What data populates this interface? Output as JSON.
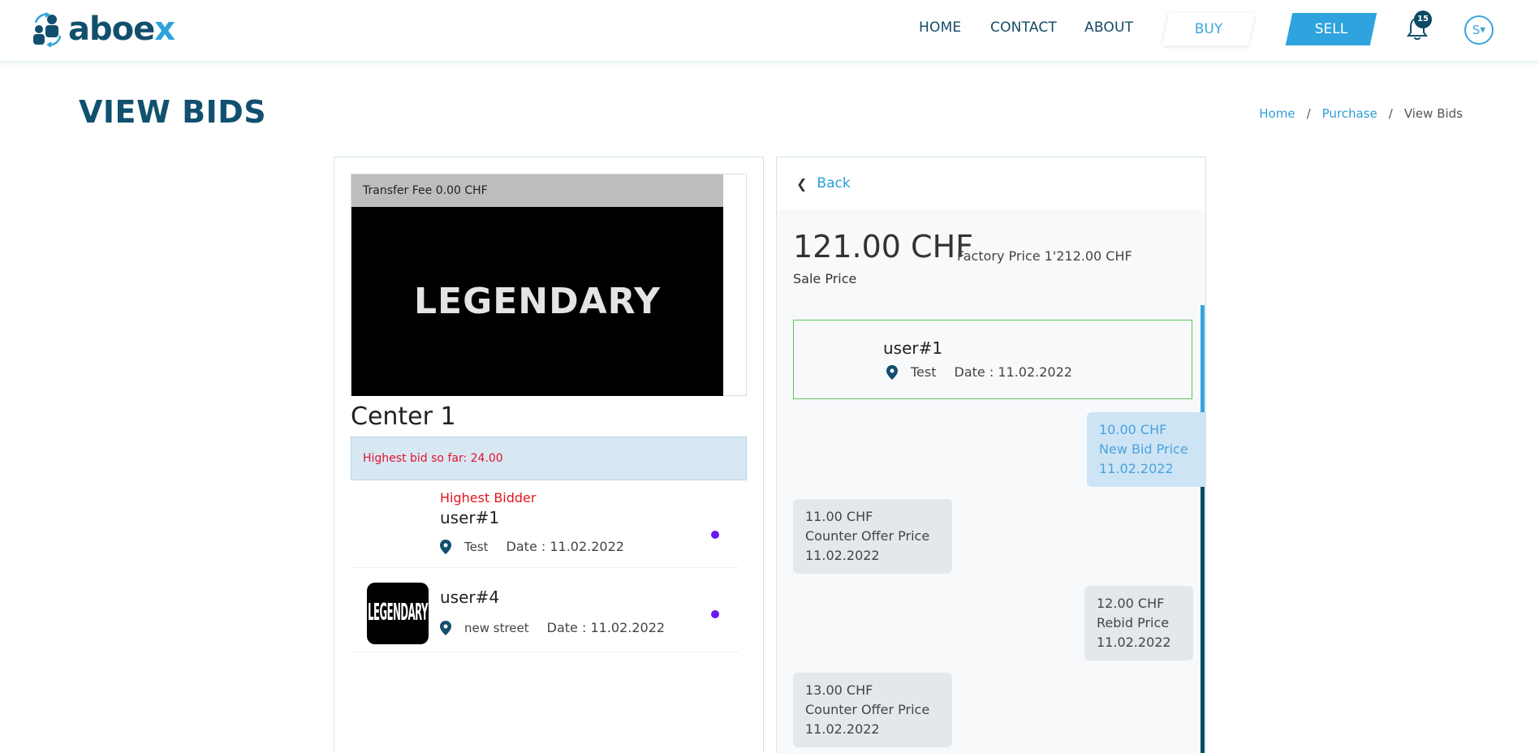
{
  "header": {
    "logo_text_main": "aboe",
    "logo_text_accent": "x",
    "nav": {
      "home": "HOME",
      "contact": "CONTACT",
      "about": "ABOUT"
    },
    "buy_label": "BUY",
    "sell_label": "SELL",
    "notification_count": "15",
    "avatar_initial": "S",
    "icons": {
      "bell": "bell-icon",
      "dropdown": "caret-down-icon"
    }
  },
  "page": {
    "title": "VIEW BIDS",
    "breadcrumb": {
      "home": "Home",
      "sep1": "/",
      "purchase": "Purchase",
      "sep2": "/",
      "current": "View Bids"
    }
  },
  "product": {
    "transfer_fee": "Transfer Fee 0.00 CHF",
    "video_text": "LEGENDARY",
    "name": "Center 1",
    "highest_bid": "Highest bid so far: 24.00"
  },
  "bidders": [
    {
      "badge": "Highest Bidder",
      "name": "user#1",
      "location": "Test",
      "date": "Date : 11.02.2022"
    },
    {
      "badge": "",
      "name": "user#4",
      "location": "new street",
      "date": "Date : 11.02.2022",
      "thumb_text": "LEGENDARY"
    }
  ],
  "detail": {
    "back_label": "Back",
    "sale_price": "121.00 CHF",
    "factory_price": "Factory Price 1'212.00 CHF",
    "sale_label": "Sale Price",
    "selected_bidder": {
      "name": "user#1",
      "location": "Test",
      "date": "Date : 11.02.2022"
    },
    "messages": [
      {
        "side": "out",
        "amount": "10.00 CHF",
        "type": "New Bid Price",
        "date": "11.02.2022"
      },
      {
        "side": "in",
        "amount": "11.00 CHF",
        "type": "Counter Offer Price",
        "date": "11.02.2022"
      },
      {
        "side": "out",
        "amount": "12.00 CHF",
        "type": "Rebid Price",
        "date": "11.02.2022"
      },
      {
        "side": "in",
        "amount": "13.00 CHF",
        "type": "Counter Offer Price",
        "date": "11.02.2022"
      }
    ]
  },
  "colors": {
    "brand_dark": "#11506f",
    "accent": "#2ea3dd",
    "highest_red": "#e1132e",
    "status_dot": "#6a16f5",
    "selected_border": "#5fc55a"
  }
}
